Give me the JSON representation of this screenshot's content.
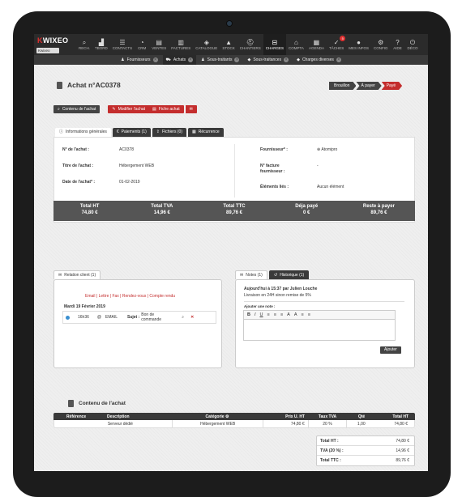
{
  "app": {
    "logo": "KWIXEO",
    "selector": "Kwixeo"
  },
  "nav": [
    {
      "label": "RECH.",
      "icon": "search-icon"
    },
    {
      "label": "TBORD",
      "icon": "chart-icon"
    },
    {
      "label": "CONTACTS",
      "icon": "contacts-icon"
    },
    {
      "label": "CRM",
      "icon": "crm-icon"
    },
    {
      "label": "VENTES",
      "icon": "ventes-icon"
    },
    {
      "label": "FACTURES",
      "icon": "factures-icon"
    },
    {
      "label": "CATALOGUE",
      "icon": "catalogue-icon"
    },
    {
      "label": "STOCK",
      "icon": "stock-icon"
    },
    {
      "label": "CHANTIERS",
      "icon": "chantiers-icon"
    },
    {
      "label": "CHARGES",
      "icon": "charges-icon"
    },
    {
      "label": "COMPTA",
      "icon": "compta-icon"
    },
    {
      "label": "AGENDA",
      "icon": "agenda-icon"
    },
    {
      "label": "TÂCHES",
      "icon": "taches-icon",
      "badge": "5"
    },
    {
      "label": "MES INFOS",
      "icon": "user-icon"
    },
    {
      "label": "CONFIG",
      "icon": "gear-icon"
    },
    {
      "label": "AIDE",
      "icon": "help-icon"
    },
    {
      "label": "DÉCO",
      "icon": "power-icon"
    }
  ],
  "subtabs": [
    "Fournisseurs",
    "Achats",
    "Sous-traitants",
    "Sous-traitances",
    "Charges diverses"
  ],
  "page": {
    "title": "Achat n°AC0378"
  },
  "steps": [
    "Brouillon",
    "À payer",
    "Payé"
  ],
  "buttons": {
    "contenu": "Contenu de l'achat",
    "modifier": "Modifier l'achat",
    "fiche": "Fiche achat"
  },
  "tabs": [
    "Informations générales",
    "Paiements (1)",
    "Fichiers (0)",
    "Récurrence"
  ],
  "info": {
    "numero_label": "N° de l'achat :",
    "numero": "AC0378",
    "titre_label": "Titre de l'achat :",
    "titre": "Hébergement WEB",
    "date_label": "Date de l'achat* :",
    "date": "01-02-2019",
    "fournisseur_label": "Fournisseur* :",
    "fournisseur": "Atomipro",
    "facture_label": "N° facture fournisseur :",
    "facture": "-",
    "elements_label": "Éléments liés :",
    "elements": "Aucun élément"
  },
  "totals": [
    {
      "label": "Total HT",
      "value": "74,80 €"
    },
    {
      "label": "Total TVA",
      "value": "14,96 €"
    },
    {
      "label": "Total TTC",
      "value": "89,76 €"
    },
    {
      "label": "Déja payé",
      "value": "0 €"
    },
    {
      "label": "Reste à payer",
      "value": "89,76 €"
    }
  ],
  "relation": {
    "tab": "Relation client (1)",
    "links": "Email | Lettre | Fax | Rendez-vous | Compte rendu",
    "date": "Mardi 19 Février 2019",
    "time": "16h36",
    "type": "EMAIL",
    "subject_label": "Sujet :",
    "subject": "Bon de commande"
  },
  "notes": {
    "tab_notes": "Notes (1)",
    "tab_hist": "Historique (1)",
    "header": "Aujourd'hui à 15:37 par Julien Louche",
    "text": "Livraison en 24H sinon remise de 5%",
    "add_label": "Ajouter une note :",
    "toolbar": [
      "B",
      "I",
      "U",
      "≡",
      "≡",
      "≡",
      "A",
      "A",
      "≡",
      "≡"
    ],
    "add_button": "Ajouter"
  },
  "contenu": {
    "title": "Contenu de l'achat",
    "headers": [
      "Référence",
      "Description",
      "Catégorie",
      "Prix U. HT",
      "Taux TVA",
      "Qté",
      "Total HT"
    ],
    "row": [
      "",
      "Serveur dédié",
      "Hébergement WEB",
      "74,80 €",
      "20 %",
      "1,00",
      "74,80 €"
    ]
  },
  "summary": [
    {
      "label": "Total HT :",
      "value": "74,80 €"
    },
    {
      "label": "TVA (20 %) :",
      "value": "14,96 €"
    },
    {
      "label": "Total TTC :",
      "value": "89,76 €"
    }
  ],
  "colors": {
    "accent": "#c42d2d",
    "dark": "#3a3a3a"
  }
}
